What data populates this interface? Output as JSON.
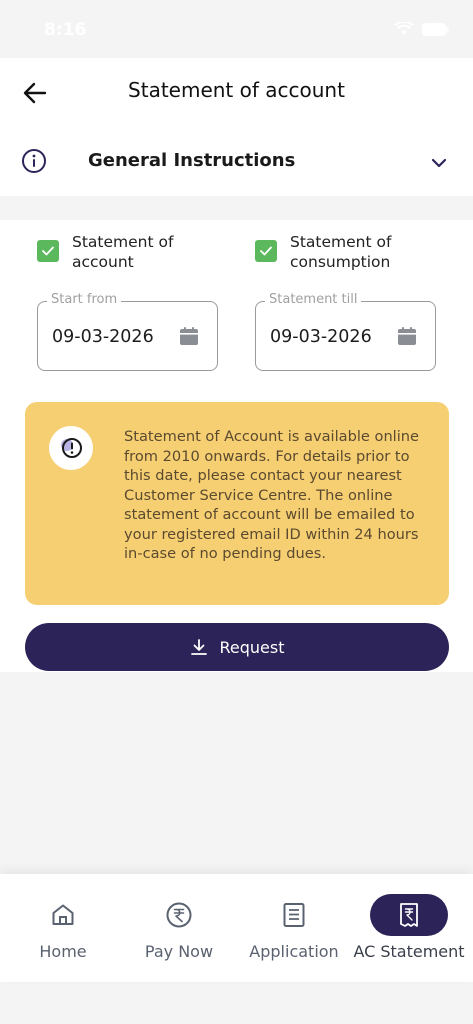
{
  "status_bar": {
    "time": "8:16"
  },
  "header": {
    "title": "Statement of account"
  },
  "instructions": {
    "title": "General Instructions"
  },
  "form": {
    "checkboxes": [
      {
        "label": "Statement of account",
        "checked": true
      },
      {
        "label": "Statement of consumption",
        "checked": true
      }
    ],
    "start_date": {
      "label": "Start from",
      "value": "09-03-2026"
    },
    "end_date": {
      "label": "Statement till",
      "value": "09-03-2026"
    },
    "notice": "Statement of Account is available online from 2010 onwards. For details prior to this date, please contact your nearest Customer Service Centre. The online statement of account will be emailed to your registered email ID within 24 hours in-case of no pending dues.",
    "request_label": "Request"
  },
  "bottom_nav": {
    "items": [
      {
        "label": "Home",
        "icon": "home-icon"
      },
      {
        "label": "Pay Now",
        "icon": "rupee-icon"
      },
      {
        "label": "Application",
        "icon": "document-icon"
      },
      {
        "label": "AC Statement",
        "icon": "statement-icon",
        "active": true
      }
    ]
  },
  "colors": {
    "primary": "#2c2458",
    "checkbox": "#5cb85c",
    "notice_bg": "#f7cf73",
    "notice_text": "#5a4a2f"
  }
}
